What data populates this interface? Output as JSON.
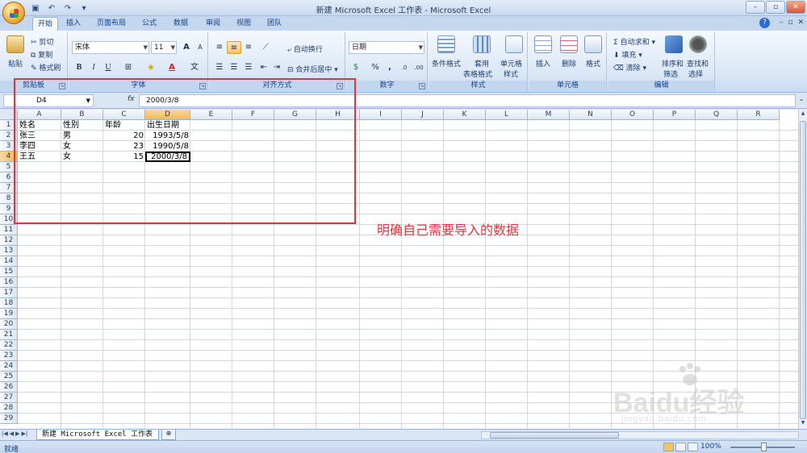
{
  "window": {
    "title": "新建 Microsoft Excel 工作表 - Microsoft Excel"
  },
  "qat": {
    "icons": [
      "save-icon",
      "undo-icon",
      "redo-icon",
      "customize-icon"
    ]
  },
  "tabs": [
    "开始",
    "插入",
    "页面布局",
    "公式",
    "数据",
    "审阅",
    "视图",
    "团队"
  ],
  "ribbon": {
    "clipboard": {
      "label": "剪贴板",
      "paste": "粘贴",
      "cut": "剪切",
      "copy": "复制",
      "format_painter": "格式刷"
    },
    "font": {
      "label": "字体",
      "name": "宋体",
      "size": "11",
      "bold": "B",
      "italic": "I",
      "underline": "U",
      "font_color": "A",
      "grow": "A",
      "shrink": "A"
    },
    "alignment": {
      "label": "对齐方式",
      "wrap": "自动换行",
      "merge": "合并后居中"
    },
    "number": {
      "label": "数字",
      "format": "日期",
      "percent": "%",
      "comma": ",",
      "inc_dec": ".0",
      "dec_dec": ".00"
    },
    "styles": {
      "label": "样式",
      "conditional": "条件格式",
      "table1": "套用",
      "table2": "表格格式",
      "cell1": "单元格",
      "cell2": "样式"
    },
    "cells": {
      "label": "单元格",
      "insert": "插入",
      "delete": "删除",
      "format": "格式"
    },
    "editing": {
      "label": "编辑",
      "autosum": "自动求和",
      "fill": "填充",
      "clear": "清除",
      "sort1": "排序和",
      "sort2": "筛选",
      "find1": "查找和",
      "find2": "选择"
    }
  },
  "formula_bar": {
    "name_box": "D4",
    "fx": "fx",
    "value": "2000/3/8"
  },
  "columns": [
    "A",
    "B",
    "C",
    "D",
    "E",
    "F",
    "G",
    "H",
    "I",
    "J",
    "K",
    "L",
    "M",
    "N",
    "O",
    "P",
    "Q",
    "R"
  ],
  "rows": [
    "1",
    "2",
    "3",
    "4",
    "5",
    "6",
    "7",
    "8",
    "9",
    "10",
    "11",
    "12",
    "13",
    "14",
    "15",
    "16",
    "17",
    "18",
    "19",
    "20",
    "21",
    "22",
    "23",
    "24",
    "25",
    "26",
    "27",
    "28",
    "29"
  ],
  "cells": [
    [
      "姓名",
      "性别",
      "年龄",
      "出生日期"
    ],
    [
      "张三",
      "男",
      "20",
      "1993/5/8"
    ],
    [
      "李四",
      "女",
      "23",
      "1990/5/8"
    ],
    [
      "王五",
      "女",
      "15",
      "2000/3/8"
    ]
  ],
  "annotation": "明确自己需要导入的数据",
  "sheet_tab": "新建 Microsoft Excel 工作表",
  "status": {
    "text": "就绪",
    "zoom": "100%"
  },
  "watermark": {
    "brand": "Baidu经验",
    "url": "jingyan.baidu.com"
  },
  "colors": {
    "annotation": "#e8323a",
    "ribbon": "#dbe7f6",
    "active_header": "#f1b95a"
  }
}
